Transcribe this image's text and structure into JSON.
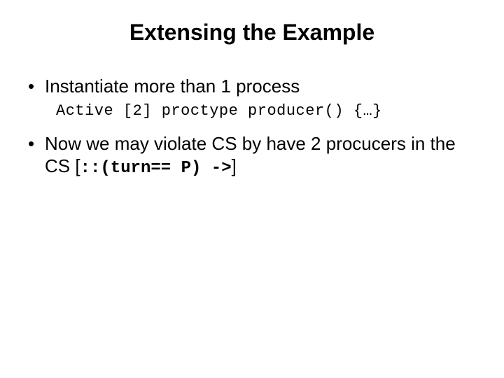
{
  "title": "Extensing the Example",
  "bullet1": "Instantiate more than 1 process",
  "code": "Active [2] proctype producer() {…}",
  "bullet2_part1": "Now we may violate CS by have 2 procucers in the CS [",
  "bullet2_code": "::(turn== P) ->",
  "bullet2_part2": "]"
}
